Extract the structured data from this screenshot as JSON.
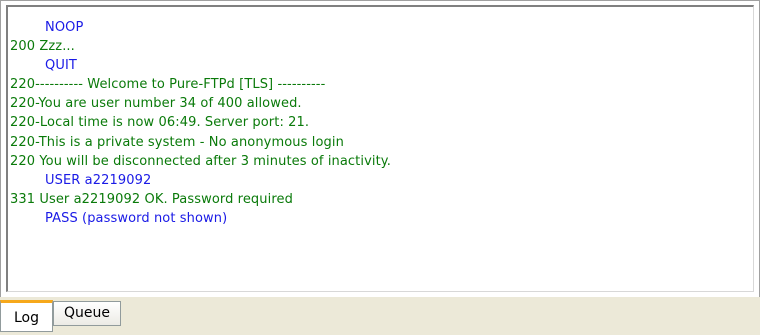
{
  "log": {
    "lines": [
      {
        "type": "command",
        "text": "NOOP"
      },
      {
        "type": "response",
        "text": "200 Zzz..."
      },
      {
        "type": "command",
        "text": "QUIT"
      },
      {
        "type": "response",
        "text": "220---------- Welcome to Pure-FTPd [TLS] ----------"
      },
      {
        "type": "response",
        "text": "220-You are user number 34 of 400 allowed."
      },
      {
        "type": "response",
        "text": "220-Local time is now 06:49. Server port: 21."
      },
      {
        "type": "response",
        "text": "220-This is a private system - No anonymous login"
      },
      {
        "type": "response",
        "text": "220 You will be disconnected after 3 minutes of inactivity."
      },
      {
        "type": "command",
        "text": "USER a2219092"
      },
      {
        "type": "response",
        "text": "331 User a2219092 OK. Password required"
      },
      {
        "type": "command",
        "text": "PASS (password not shown)"
      }
    ],
    "colors": {
      "command": "#1a1ae6",
      "response": "#0a7a0a"
    }
  },
  "tabs": [
    {
      "label": "Log",
      "active": true
    },
    {
      "label": "Queue",
      "active": false
    }
  ]
}
